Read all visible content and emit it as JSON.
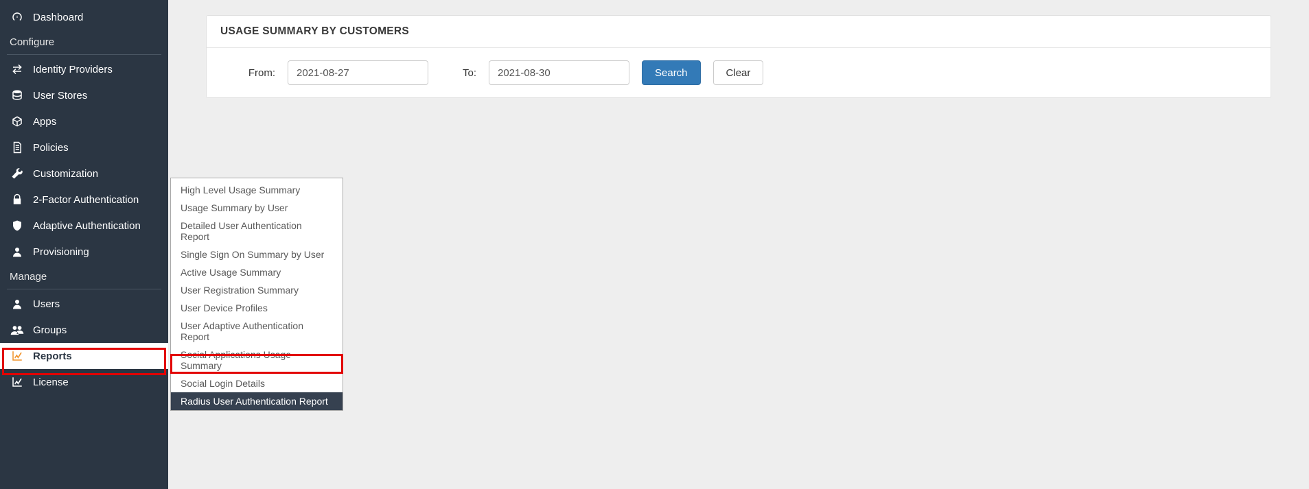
{
  "sidebar": {
    "items": [
      {
        "label": "Dashboard",
        "icon": "gauge-icon"
      }
    ],
    "configure_header": "Configure",
    "configure_items": [
      {
        "label": "Identity Providers",
        "icon": "exchange-icon"
      },
      {
        "label": "User Stores",
        "icon": "database-icon"
      },
      {
        "label": "Apps",
        "icon": "cube-icon"
      },
      {
        "label": "Policies",
        "icon": "document-icon"
      },
      {
        "label": "Customization",
        "icon": "wrench-icon"
      },
      {
        "label": "2-Factor Authentication",
        "icon": "lock-icon"
      },
      {
        "label": "Adaptive Authentication",
        "icon": "shield-icon"
      },
      {
        "label": "Provisioning",
        "icon": "user-icon"
      }
    ],
    "manage_header": "Manage",
    "manage_items": [
      {
        "label": "Users",
        "icon": "user-icon"
      },
      {
        "label": "Groups",
        "icon": "group-icon"
      },
      {
        "label": "Reports",
        "icon": "chart-icon",
        "active": true
      },
      {
        "label": "License",
        "icon": "chart-icon"
      }
    ]
  },
  "submenu": {
    "items": [
      "High Level Usage Summary",
      "Usage Summary by User",
      "Detailed User Authentication Report",
      "Single Sign On Summary by User",
      "Active Usage Summary",
      "User Registration Summary",
      "User Device Profiles",
      "User Adaptive Authentication Report",
      "Social Applications Usage Summary",
      "Social Login Details",
      "Radius User Authentication Report"
    ],
    "highlight_index": 10
  },
  "panel": {
    "title": "USAGE SUMMARY BY CUSTOMERS",
    "from_label": "From:",
    "to_label": "To:",
    "from_value": "2021-08-27",
    "to_value": "2021-08-30",
    "search_label": "Search",
    "clear_label": "Clear"
  }
}
